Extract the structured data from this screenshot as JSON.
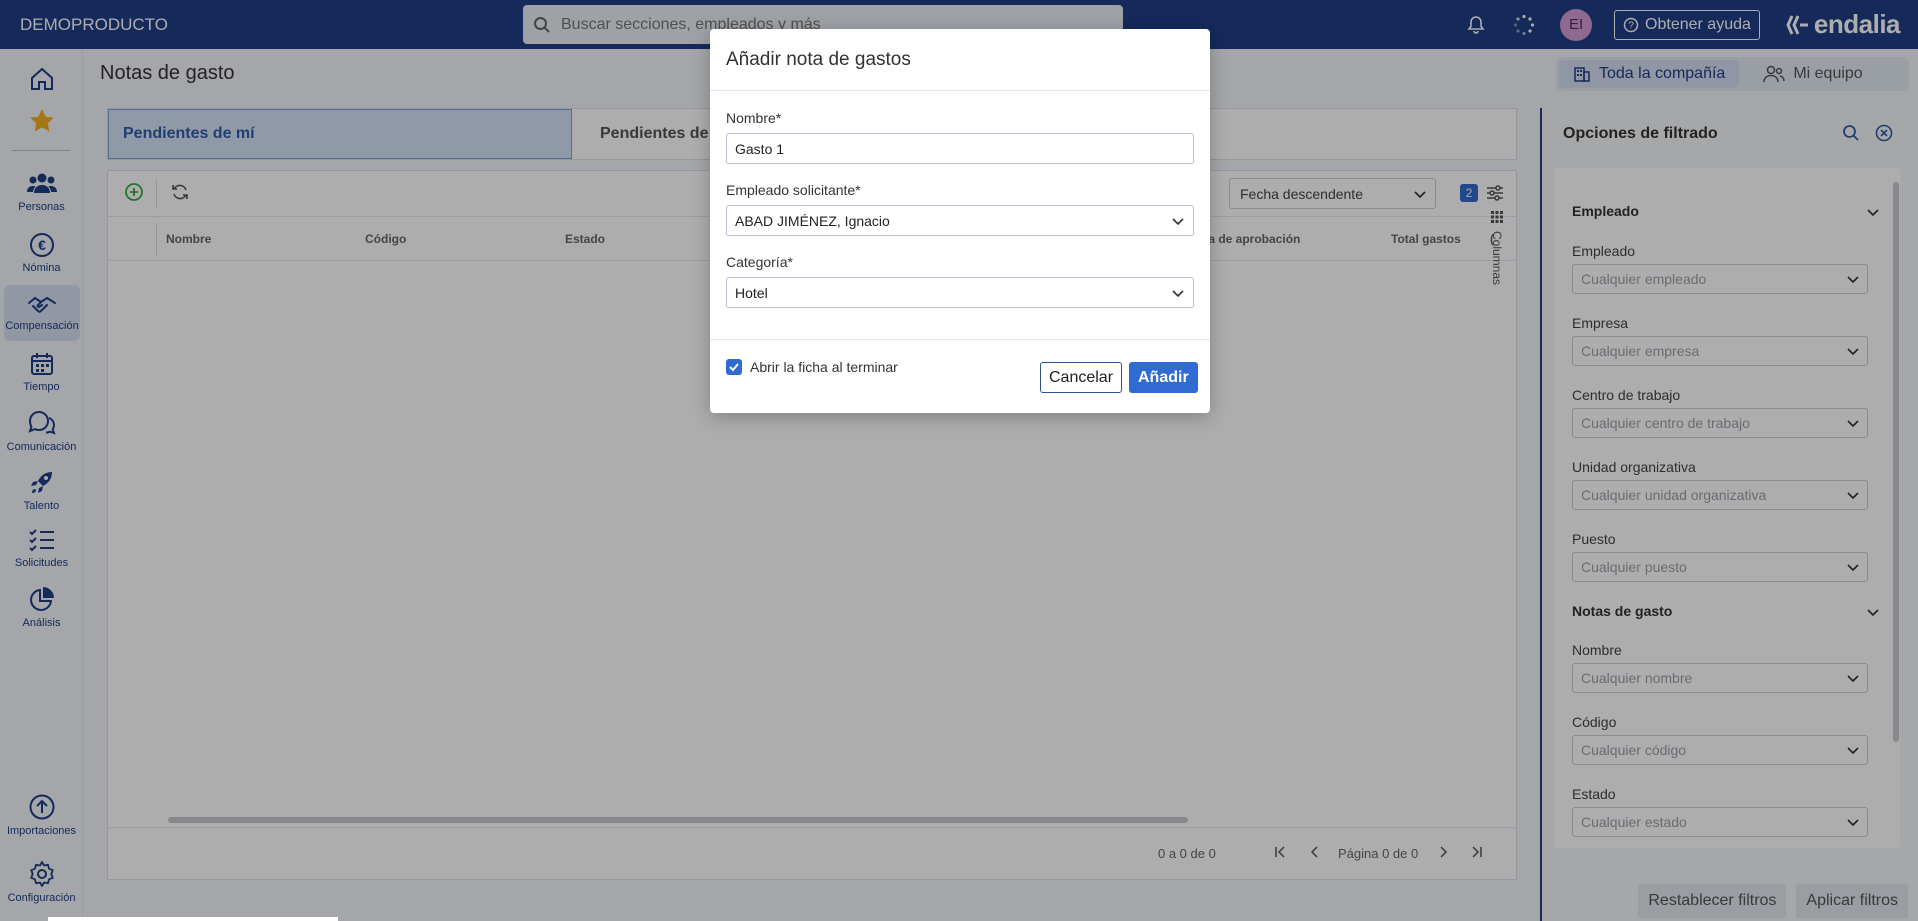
{
  "app": {
    "brand": "DEMOPRODUCTO",
    "logo_text": "endalia"
  },
  "topbar": {
    "search_placeholder": "Buscar secciones, empleados y más",
    "avatar_initials": "EI",
    "help_label": "Obtener ayuda"
  },
  "sidebar": {
    "items": [
      {
        "label": "Personas",
        "icon": "people-icon"
      },
      {
        "label": "Nómina",
        "icon": "euro-icon"
      },
      {
        "label": "Compensación",
        "icon": "handshake-icon",
        "active": true
      },
      {
        "label": "Tiempo",
        "icon": "calendar-icon"
      },
      {
        "label": "Comunicación",
        "icon": "chat-icon"
      },
      {
        "label": "Talento",
        "icon": "rocket-icon"
      },
      {
        "label": "Solicitudes",
        "icon": "checklist-icon"
      },
      {
        "label": "Análisis",
        "icon": "piechart-icon"
      },
      {
        "label": "Importaciones",
        "icon": "upload-icon"
      },
      {
        "label": "Configuración",
        "icon": "gear-icon"
      }
    ]
  },
  "main": {
    "title": "Notas de gasto",
    "scope": {
      "company": "Toda la compañía",
      "team": "Mi equipo"
    },
    "tabs": [
      {
        "label": "Pendientes de mí"
      },
      {
        "label": "Pendientes de o"
      }
    ],
    "sort": {
      "value": "Fecha descendente"
    },
    "filters_badge": "2",
    "columns": [
      "Nombre",
      "Código",
      "Estado",
      "ha de aprobación",
      "Total gastos",
      "("
    ],
    "columns_toggle": "Columnas",
    "pager": {
      "count": "0 a 0 de 0",
      "page": "Página 0 de 0"
    }
  },
  "filters": {
    "title": "Opciones de filtrado",
    "sections": [
      {
        "title": "Empleado",
        "fields": [
          {
            "label": "Empleado",
            "placeholder": "Cualquier empleado"
          },
          {
            "label": "Empresa",
            "placeholder": "Cualquier empresa"
          },
          {
            "label": "Centro de trabajo",
            "placeholder": "Cualquier centro de trabajo"
          },
          {
            "label": "Unidad organizativa",
            "placeholder": "Cualquier unidad organizativa"
          },
          {
            "label": "Puesto",
            "placeholder": "Cualquier puesto"
          }
        ]
      },
      {
        "title": "Notas de gasto",
        "fields": [
          {
            "label": "Nombre",
            "placeholder": "Cualquier nombre"
          },
          {
            "label": "Código",
            "placeholder": "Cualquier código"
          },
          {
            "label": "Estado",
            "placeholder": "Cualquier estado"
          }
        ]
      }
    ],
    "reset_label": "Restablecer filtros",
    "apply_label": "Aplicar filtros"
  },
  "modal": {
    "title": "Añadir nota de gastos",
    "name_label": "Nombre*",
    "name_value": "Gasto 1",
    "employee_label": "Empleado solicitante*",
    "employee_value": "ABAD JIMÉNEZ, Ignacio",
    "category_label": "Categoría*",
    "category_value": "Hotel",
    "open_after_label": "Abrir la ficha al terminar",
    "open_after_checked": true,
    "cancel_label": "Cancelar",
    "add_label": "Añadir"
  },
  "colors": {
    "primary": "#1f3f86",
    "accent": "#2f6bd0",
    "add_green": "#3aa845"
  }
}
